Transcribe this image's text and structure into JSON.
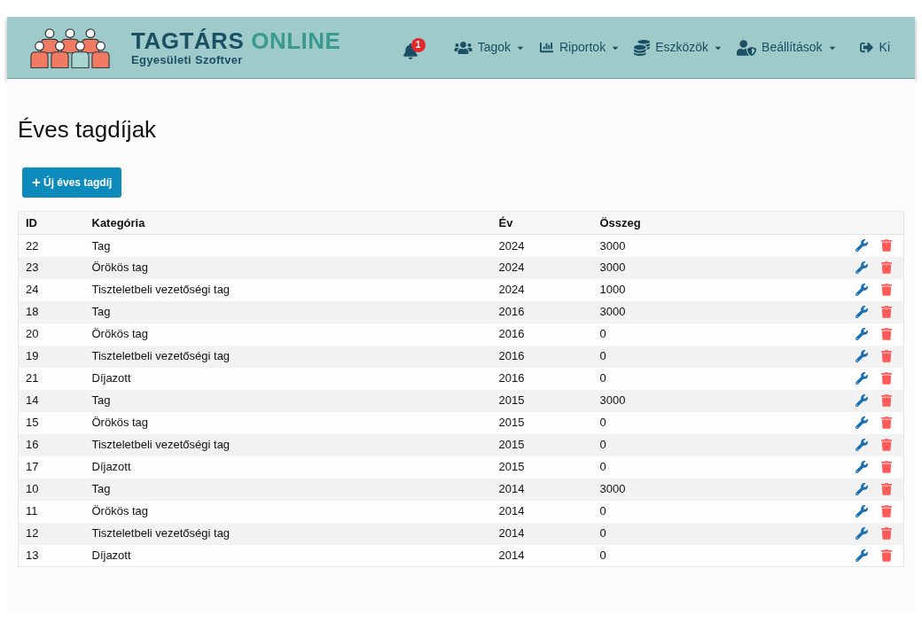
{
  "header": {
    "logo": {
      "title_main": "TAGTÁRS",
      "title_accent": "ONLINE",
      "subtitle": "Egyesületi Szoftver"
    },
    "notifications": {
      "count": "1"
    },
    "nav": [
      {
        "label": "Tagok",
        "kind": "dropdown"
      },
      {
        "label": "Riportok",
        "kind": "dropdown"
      },
      {
        "label": "Eszközök",
        "kind": "dropdown"
      },
      {
        "label": "Beállítások",
        "kind": "dropdown"
      },
      {
        "label": "Ki",
        "kind": "link"
      }
    ]
  },
  "page": {
    "title": "Éves tagdíjak",
    "new_button": "Új éves tagdíj"
  },
  "table": {
    "columns": [
      "ID",
      "Kategória",
      "Év",
      "Összeg"
    ],
    "rows": [
      {
        "id": "22",
        "category": "Tag",
        "year": "2024",
        "amount": "3000"
      },
      {
        "id": "23",
        "category": "Örökös tag",
        "year": "2024",
        "amount": "3000"
      },
      {
        "id": "24",
        "category": "Tiszteletbeli vezetőségi tag",
        "year": "2024",
        "amount": "1000"
      },
      {
        "id": "18",
        "category": "Tag",
        "year": "2016",
        "amount": "3000"
      },
      {
        "id": "20",
        "category": "Örökös tag",
        "year": "2016",
        "amount": "0"
      },
      {
        "id": "19",
        "category": "Tiszteletbeli vezetőségi tag",
        "year": "2016",
        "amount": "0"
      },
      {
        "id": "21",
        "category": "Díjazott",
        "year": "2016",
        "amount": "0"
      },
      {
        "id": "14",
        "category": "Tag",
        "year": "2015",
        "amount": "3000"
      },
      {
        "id": "15",
        "category": "Örökös tag",
        "year": "2015",
        "amount": "0"
      },
      {
        "id": "16",
        "category": "Tiszteletbeli vezetőségi tag",
        "year": "2015",
        "amount": "0"
      },
      {
        "id": "17",
        "category": "Díjazott",
        "year": "2015",
        "amount": "0"
      },
      {
        "id": "10",
        "category": "Tag",
        "year": "2014",
        "amount": "3000"
      },
      {
        "id": "11",
        "category": "Örökös tag",
        "year": "2014",
        "amount": "0"
      },
      {
        "id": "12",
        "category": "Tiszteletbeli vezetőségi tag",
        "year": "2014",
        "amount": "0"
      },
      {
        "id": "13",
        "category": "Díjazott",
        "year": "2014",
        "amount": "0"
      }
    ]
  }
}
